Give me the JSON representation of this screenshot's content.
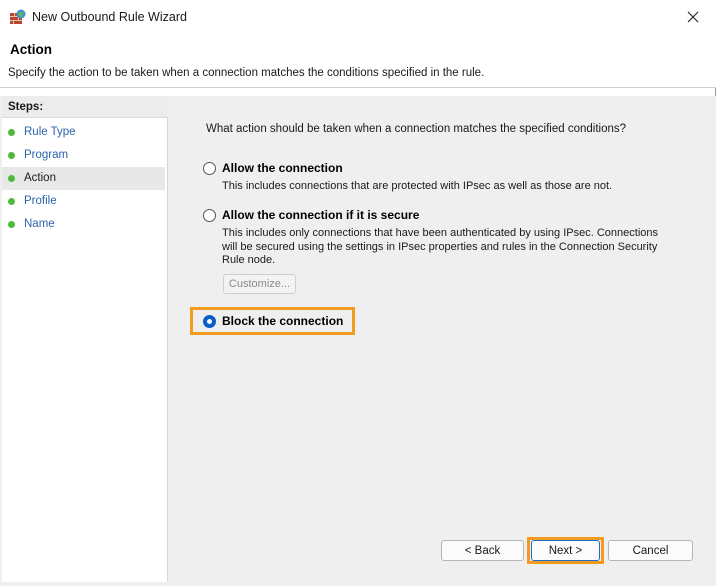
{
  "window": {
    "title": "New Outbound Rule Wizard"
  },
  "header": {
    "title": "Action",
    "description": "Specify the action to be taken when a connection matches the conditions specified in the rule."
  },
  "steps": {
    "title": "Steps:",
    "items": [
      {
        "label": "Rule Type",
        "active": false
      },
      {
        "label": "Program",
        "active": false
      },
      {
        "label": "Action",
        "active": true
      },
      {
        "label": "Profile",
        "active": false
      },
      {
        "label": "Name",
        "active": false
      }
    ]
  },
  "main": {
    "question": "What action should be taken when a connection matches the specified conditions?",
    "options": [
      {
        "label": "Allow the connection",
        "description": "This includes connections that are protected with IPsec as well as those are not.",
        "checked": false
      },
      {
        "label": "Allow the connection if it is secure",
        "description": "This includes only connections that have been authenticated by using IPsec.  Connections will be secured using the settings in IPsec properties and rules in the Connection Security Rule node.",
        "checked": false
      },
      {
        "label": "Block the connection",
        "description": "",
        "checked": true
      }
    ],
    "customize_label": "Customize..."
  },
  "buttons": {
    "back": "< Back",
    "next": "Next >",
    "cancel": "Cancel"
  },
  "colors": {
    "highlight": "#f39b1f",
    "accent": "#0a5fc7",
    "step_dot": "#4fb93a",
    "link": "#2a64ad"
  },
  "icons": {
    "app": "firewall-icon",
    "close": "close-icon"
  }
}
